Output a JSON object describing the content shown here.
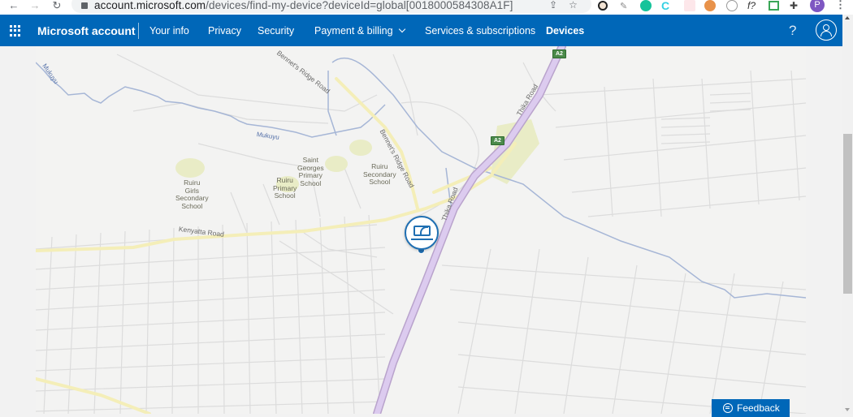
{
  "browser": {
    "url_host": "account.microsoft.com",
    "url_path": "/devices/find-my-device?deviceId=global[0018000584308A1F]",
    "profile_initial": "P",
    "extensions": [
      "screenshot-extension-icon",
      "eyedropper-icon",
      "grammarly-icon",
      "canva-icon",
      "notes-icon",
      "monkey-icon",
      "vpn-icon",
      "fx-icon",
      "green-square-icon",
      "puzzle-icon"
    ]
  },
  "header": {
    "brand": "Microsoft account",
    "nav": [
      {
        "label": "Your info"
      },
      {
        "label": "Privacy"
      },
      {
        "label": "Security"
      },
      {
        "label": "Payment & billing"
      },
      {
        "label": "Services & subscriptions"
      },
      {
        "label": "Devices",
        "active": true
      }
    ],
    "help_label": "?"
  },
  "map": {
    "labels": {
      "ruiru_girls": "Ruiru\nGirls\nSecondary\nSchool",
      "saint_georges": "Saint\nGeorges\nPrimary\nSchool",
      "ruiru_primary": "Ruiru\nPrimary\nSchool",
      "ruiru_secondary": "Ruiru\nSecondary\nSchool"
    },
    "roads": {
      "kenyatta": "Kenyatta Road",
      "bennets_1": "Bennet's Ridge Road",
      "bennets_2": "Bennet's Ridge Road",
      "thika_1": "Thika Road",
      "thika_2": "Thika Road"
    },
    "rivers": {
      "mukuyu_1": "Mukuyu",
      "mukuyu_2": "Mukuyu"
    },
    "shields": {
      "a2_top": "A2",
      "a2_mid": "A2"
    },
    "device_pin": "laptop-device-location"
  },
  "feedback": {
    "label": "Feedback"
  }
}
